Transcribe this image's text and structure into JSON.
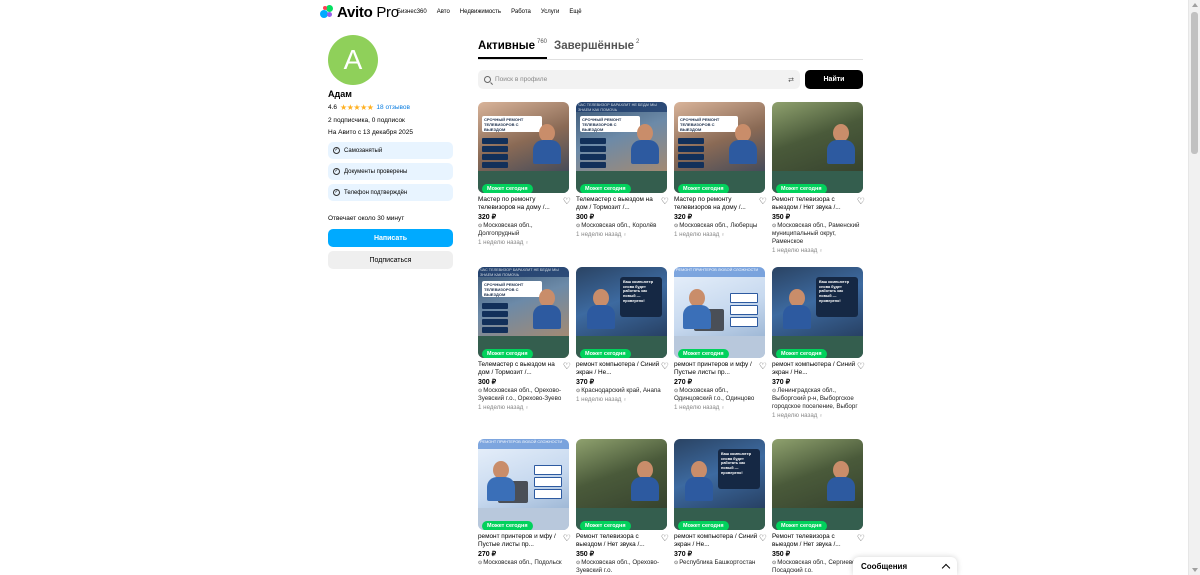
{
  "header": {
    "logo_text": "Avito",
    "logo_pro": "Pro",
    "nav": [
      "Бизнес360",
      "Авто",
      "Недвижимость",
      "Работа",
      "Услуги",
      "Ещё"
    ]
  },
  "profile": {
    "avatar_letter": "А",
    "name": "Адам",
    "rating": "4.6",
    "stars": 4.6,
    "reviews": "18 отзывов",
    "subs": "2 подписчика, 0 подписок",
    "since": "На Авито с 13 декабря 2025",
    "badges": [
      "Самозанятый",
      "Документы проверены",
      "Телефон подтверждён"
    ],
    "responds": "Отвечает около 30 минут",
    "write_btn": "Написать",
    "subscribe_btn": "Подписаться"
  },
  "tabs": [
    {
      "label": "Активные",
      "count": "760"
    },
    {
      "label": "Завершённые",
      "count": "2"
    }
  ],
  "search": {
    "placeholder": "Поиск в профиле",
    "button": "Найти"
  },
  "tag_today": "Может сегодня",
  "cards": [
    {
      "title": "Мастер по ремонту телевизоров на дому /...",
      "price": "320 ₽",
      "loc": "Московская обл., Долгопрудный",
      "date": "1 неделю назад",
      "img": "tv1"
    },
    {
      "title": "Телемастер с выездом на дом / Тормозит /...",
      "price": "300 ₽",
      "loc": "Московская обл., Королёв",
      "date": "1 неделю назад",
      "img": "tv2"
    },
    {
      "title": "Мастер по ремонту телевизоров на дому /...",
      "price": "320 ₽",
      "loc": "Московская обл., Люберцы",
      "date": "1 неделю назад",
      "img": "tv1"
    },
    {
      "title": "Ремонт телевизора с выездом / Нет звука /...",
      "price": "350 ₽",
      "loc": "Московская обл., Раменский муниципальный округ, Раменское",
      "date": "1 неделю назад",
      "img": "man"
    },
    {
      "title": "Телемастер с выездом на дом / Тормозит /...",
      "price": "300 ₽",
      "loc": "Московская обл., Орехово-Зуевский г.о., Орехово-Зуево",
      "date": "1 неделю назад",
      "img": "tv2"
    },
    {
      "title": "ремонт компьютера / Синий экран / Не...",
      "price": "370 ₽",
      "loc": "Краснодарский край, Анапа",
      "date": "1 неделю назад",
      "img": "pc"
    },
    {
      "title": "ремонт принтеров и мфу / Пустые листы пр...",
      "price": "270 ₽",
      "loc": "Московская обл., Одинцовский г.о., Одинцово",
      "date": "1 неделю назад",
      "img": "printer"
    },
    {
      "title": "ремонт компьютера / Синий экран / Не...",
      "price": "370 ₽",
      "loc": "Ленинградская обл., Выборгский р-н, Выборгское городское поселение, Выборг",
      "date": "1 неделю назад",
      "img": "pc"
    },
    {
      "title": "ремонт принтеров и мфу / Пустые листы пр...",
      "price": "270 ₽",
      "loc": "Московская обл., Подольск",
      "date": "",
      "img": "printer"
    },
    {
      "title": "Ремонт телевизора с выездом / Нет звука /...",
      "price": "350 ₽",
      "loc": "Московская обл., Орехово-Зуевский г.о.",
      "date": "",
      "img": "man"
    },
    {
      "title": "ремонт компьютера / Синий экран / Не...",
      "price": "370 ₽",
      "loc": "Республика Башкортостан",
      "date": "",
      "img": "pc"
    },
    {
      "title": "Ремонт телевизора с выездом / Нет звука /...",
      "price": "350 ₽",
      "loc": "Московская обл., Сергиево-Посадский г.о.",
      "date": "",
      "img": "man"
    }
  ],
  "image_texts": {
    "tv1": "СРОЧНЫЙ РЕМОНТ ТЕЛЕВИЗОРОВ С ВЫЕЗДОМ",
    "tv2": "ЧАС ТЕЛЕВИЗОР БАРАХЛИТ НЕ БЕДА! МЫ ЗНАЕМ КАК ПОМОЧЬ",
    "pc": "Ваш компьютер снова будет работать как новый — проверено!",
    "printer": "РЕМОНТ ПРИНТЕРОВ ЛЮБОЙ СЛОЖНОСТИ"
  },
  "messages": "Сообщения"
}
